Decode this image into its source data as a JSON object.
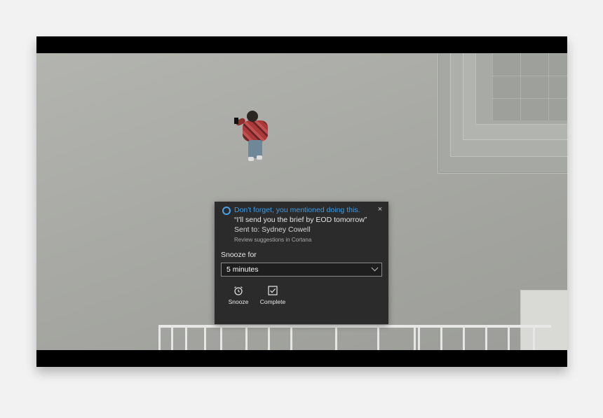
{
  "toast": {
    "headline": "Don't forget, you mentioned doing this.",
    "quote": "“I'll send you the brief by EOD tomorrow”",
    "sent_to": "Sent to: Sydney Cowell",
    "review_link": "Review suggestions in Cortana",
    "close_glyph": "×",
    "snooze_label": "Snooze for",
    "snooze_selected": "5 minutes",
    "actions": [
      {
        "label": "Snooze",
        "icon": "alarm-clock-icon"
      },
      {
        "label": "Complete",
        "icon": "checkbox-icon"
      }
    ],
    "accent_color": "#3d9be3",
    "background_color": "#2b2b2b"
  }
}
